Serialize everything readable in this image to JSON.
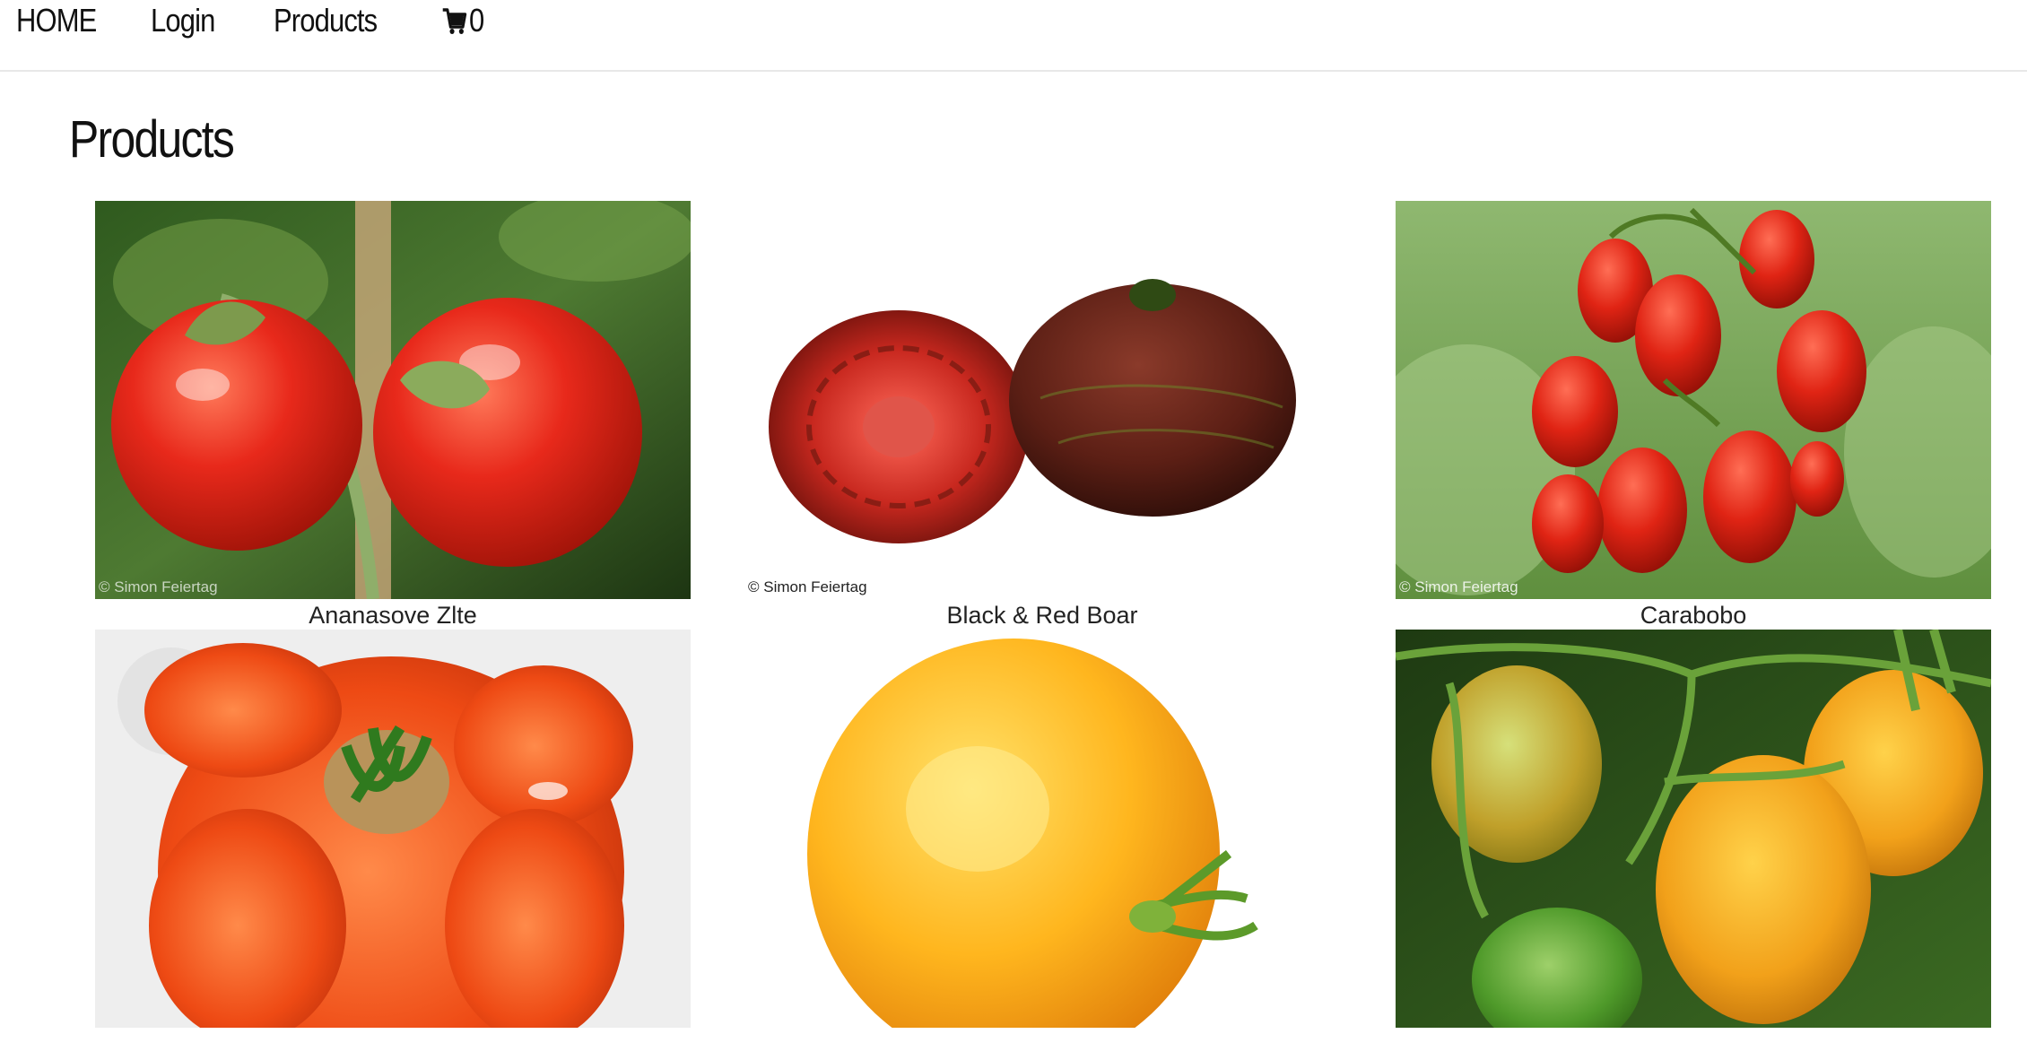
{
  "nav": {
    "home": "HOME",
    "login": "Login",
    "products": "Products",
    "cart_count": "0",
    "cart_icon": "shopping-cart-icon"
  },
  "page": {
    "title": "Products"
  },
  "products": [
    {
      "name": "Ananasove Zlte",
      "watermark": "© Simon Feiertag"
    },
    {
      "name": "Black & Red Boar",
      "watermark": "© Simon Feiertag"
    },
    {
      "name": "Carabobo",
      "watermark": "© Simon Feiertag"
    },
    {
      "name": ""
    },
    {
      "name": ""
    },
    {
      "name": ""
    }
  ],
  "colors": {
    "text": "#111111",
    "divider": "#e8e8e8",
    "tomato_red": "#d9261a",
    "tomato_orange": "#ef5a1c",
    "tomato_yellow": "#f7b21f",
    "leaf_green": "#5c8a3a"
  }
}
